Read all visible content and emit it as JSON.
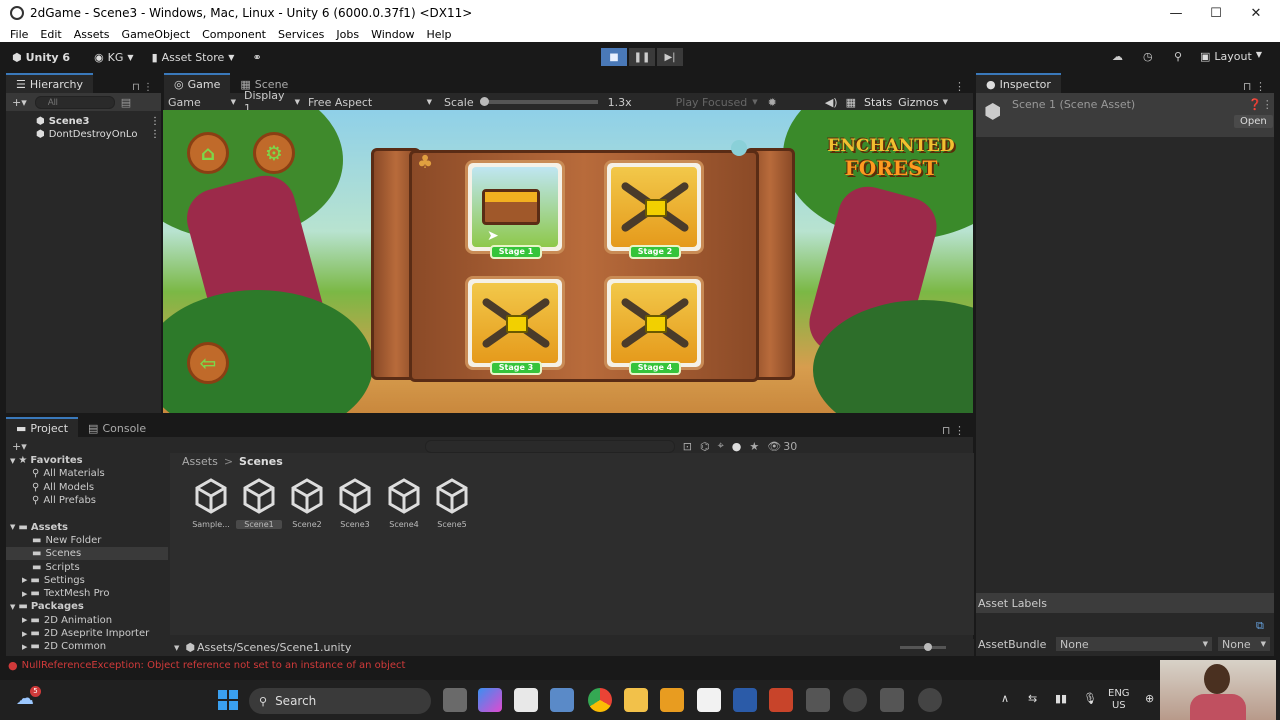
{
  "window": {
    "title": "2dGame - Scene3 - Windows, Mac, Linux - Unity 6 (6000.0.37f1) <DX11>",
    "minimize": "—",
    "maximize": "☐",
    "close": "✕"
  },
  "menu": [
    "File",
    "Edit",
    "Assets",
    "GameObject",
    "Component",
    "Services",
    "Jobs",
    "Window",
    "Help"
  ],
  "toolbar": {
    "unity_label": "Unity 6",
    "account": "KG",
    "asset_store": "Asset Store",
    "layout": "Layout"
  },
  "hierarchy": {
    "tab": "Hierarchy",
    "search_placeholder": "All",
    "items": [
      "Scene3",
      "DontDestroyOnLo"
    ]
  },
  "game": {
    "tab_game": "Game",
    "tab_scene": "Scene",
    "mode": "Game",
    "display": "Display 1",
    "aspect": "Free Aspect",
    "scale_label": "Scale",
    "scale_value": "1.3x",
    "play_focused": "Play Focused",
    "stats": "Stats",
    "gizmos": "Gizmos",
    "logo_line1": "ENCHANTED",
    "logo_line2": "FOREST",
    "stages": [
      "Stage 1",
      "Stage 2",
      "Stage 3",
      "Stage 4"
    ]
  },
  "inspector": {
    "tab": "Inspector",
    "asset": "Scene 1 (Scene Asset)",
    "open": "Open",
    "asset_labels": "Asset Labels",
    "asset_bundle": "AssetBundle",
    "bundle_value": "None",
    "variant_value": "None"
  },
  "project": {
    "tab_project": "Project",
    "tab_console": "Console",
    "hidden_count": "30",
    "favorites": "Favorites",
    "fav_items": [
      "All Materials",
      "All Models",
      "All Prefabs"
    ],
    "assets": "Assets",
    "asset_items": [
      "New Folder",
      "Scenes",
      "Scripts",
      "Settings",
      "TextMesh Pro"
    ],
    "packages": "Packages",
    "package_items": [
      "2D Animation",
      "2D Aseprite Importer",
      "2D Common"
    ],
    "breadcrumb_root": "Assets",
    "breadcrumb_sep": ">",
    "breadcrumb_current": "Scenes",
    "files": [
      "Sample...",
      "Scene1",
      "Scene2",
      "Scene3",
      "Scene4",
      "Scene5"
    ],
    "selected_path": "Assets/Scenes/Scene1.unity"
  },
  "status": {
    "error": "NullReferenceException: Object reference not set to an instance of an object"
  },
  "taskbar": {
    "search": "Search",
    "lang1": "ENG",
    "lang2": "US",
    "notif": "5"
  },
  "colors": {
    "accent": "#3a79bb",
    "error": "#d03a3a",
    "stage_green": "#35c43a"
  }
}
